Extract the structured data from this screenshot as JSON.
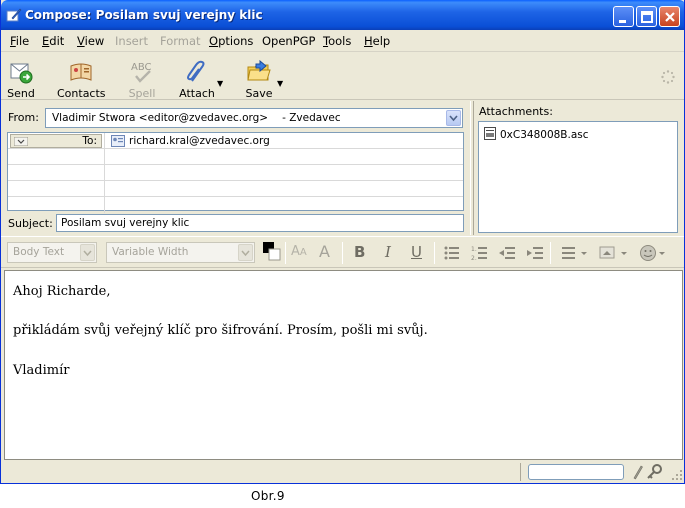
{
  "window": {
    "title": "Compose: Posilam svuj verejny klic"
  },
  "menu": [
    {
      "label": "File",
      "u": "F",
      "rest": "ile",
      "disabled": false
    },
    {
      "label": "Edit",
      "u": "E",
      "rest": "dit",
      "disabled": false
    },
    {
      "label": "View",
      "u": "V",
      "rest": "iew",
      "disabled": false
    },
    {
      "label": "Insert",
      "u": "I",
      "rest": "nsert",
      "disabled": true
    },
    {
      "label": "Format",
      "u": "",
      "rest": "Format",
      "disabled": true
    },
    {
      "label": "Options",
      "u": "O",
      "rest": "ptions",
      "disabled": false
    },
    {
      "label": "OpenPGP",
      "u": "",
      "rest": "OpenPGP",
      "disabled": false
    },
    {
      "label": "Tools",
      "u": "T",
      "rest": "ools",
      "disabled": false
    },
    {
      "label": "Help",
      "u": "H",
      "rest": "elp",
      "disabled": false
    }
  ],
  "toolbar": {
    "send": "Send",
    "contacts": "Contacts",
    "spell": "Spell",
    "spell_icon_text": "ABC",
    "attach": "Attach",
    "save": "Save"
  },
  "header": {
    "from_label": "From:",
    "from_value": "Vladimir Stwora <editor@zvedavec.org>",
    "from_account": "- Zvedavec",
    "to_label": "To:",
    "to_value": "richard.kral@zvedavec.org",
    "subject_label": "Subject:",
    "subject_value": "Posilam svuj verejny klic"
  },
  "attachments": {
    "label": "Attachments:",
    "items": [
      "0xC348008B.asc"
    ]
  },
  "format": {
    "paragraph_style": "Body Text",
    "font": "Variable Width"
  },
  "body": {
    "lines": [
      "Ahoj Richarde,",
      "přikládám svůj veřejný klíč pro šifrování. Prosím, pošli mi svůj.",
      "Vladimír"
    ]
  },
  "caption": "Obr.9",
  "colors": {
    "titlebar": "#0a4fd6",
    "chrome": "#ece9d8",
    "field_border": "#7f9db9"
  }
}
